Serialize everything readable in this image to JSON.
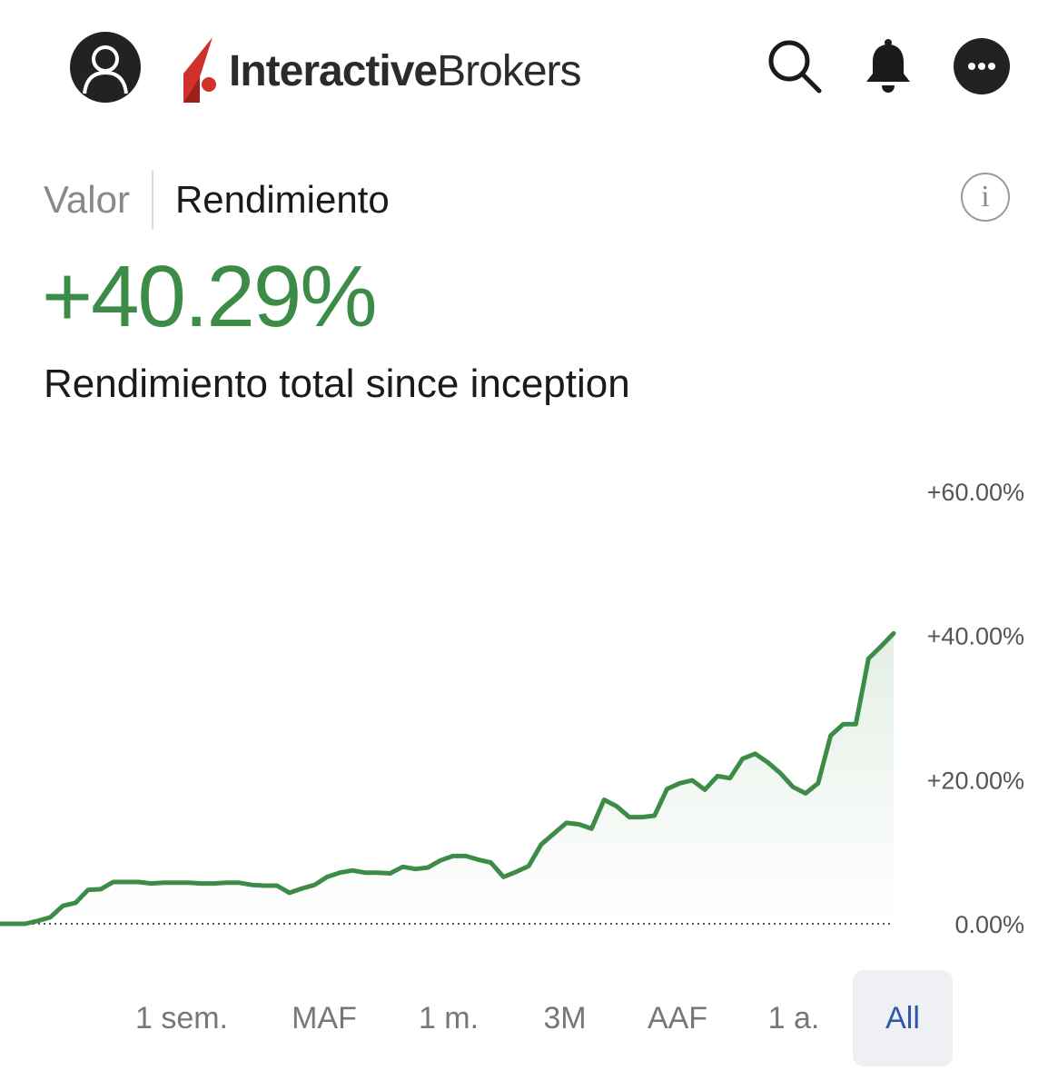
{
  "header": {
    "brand_bold": "Interactive",
    "brand_regular": "Brokers",
    "colors": {
      "brand_red": "#d0312d",
      "icon_dark": "#222222"
    },
    "icons": [
      "avatar-icon",
      "search-icon",
      "bell-icon",
      "more-icon"
    ]
  },
  "tabs": {
    "inactive": "Valor",
    "active": "Rendimiento"
  },
  "info_label": "i",
  "summary": {
    "value": "+40.29%",
    "label": "Rendimiento total since inception",
    "color": "#3c8c48"
  },
  "chart_data": {
    "type": "area",
    "y_ticks": [
      "+60.00%",
      "+40.00%",
      "+20.00%",
      "0.00%"
    ],
    "ylim": [
      0,
      60
    ],
    "baseline": 0,
    "line_color": "#3c8c48",
    "values": [
      0,
      0,
      0,
      0.4,
      0.9,
      2.5,
      2.9,
      4.7,
      4.8,
      5.8,
      5.8,
      5.8,
      5.6,
      5.7,
      5.7,
      5.7,
      5.6,
      5.6,
      5.7,
      5.7,
      5.4,
      5.3,
      5.3,
      4.3,
      4.9,
      5.4,
      6.5,
      7.1,
      7.4,
      7.1,
      7.1,
      7.0,
      7.9,
      7.6,
      7.8,
      8.8,
      9.4,
      9.4,
      8.9,
      8.5,
      6.5,
      7.2,
      8.0,
      11.0,
      12.5,
      14.0,
      13.8,
      13.2,
      17.2,
      16.3,
      14.8,
      14.8,
      15.0,
      18.7,
      19.5,
      19.9,
      18.6,
      20.5,
      20.2,
      22.9,
      23.6,
      22.4,
      20.9,
      19.0,
      18.1,
      19.5,
      26.1,
      27.7,
      27.7,
      36.8,
      38.5,
      40.3
    ]
  },
  "ranges": [
    "1 sem.",
    "MAF",
    "1 m.",
    "3M",
    "AAF",
    "1 a.",
    "All"
  ],
  "selected_range": "All"
}
